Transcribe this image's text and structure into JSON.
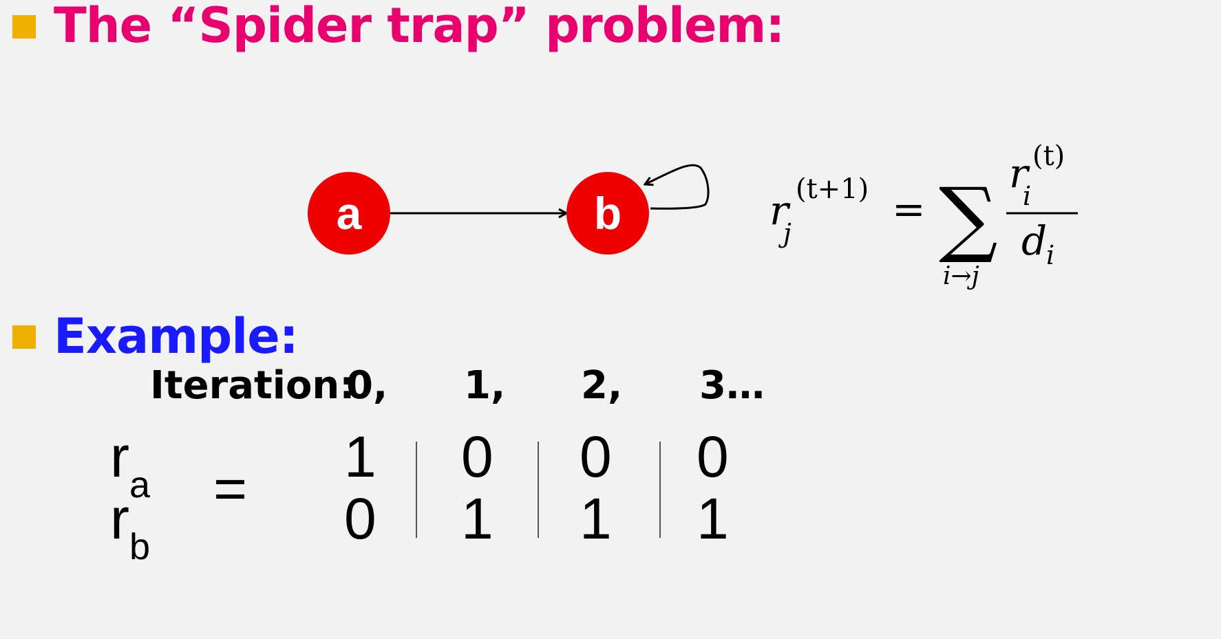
{
  "heading1": "The “Spider trap” problem:",
  "heading2": "Example:",
  "colors": {
    "heading1": "#e8006e",
    "heading2": "#1a1aff",
    "bullet": "#f0b000",
    "node": "#ee0000"
  },
  "graph": {
    "nodes": [
      {
        "id": "a",
        "label": "a"
      },
      {
        "id": "b",
        "label": "b"
      }
    ],
    "edges": [
      {
        "from": "a",
        "to": "b"
      },
      {
        "from": "b",
        "to": "b"
      }
    ]
  },
  "formula": {
    "lhs_base": "r",
    "lhs_sub": "j",
    "lhs_sup": "(t+1)",
    "equals": "=",
    "sum": "∑",
    "sum_index": "i→j",
    "num_base": "r",
    "num_sub": "i",
    "num_sup": "(t)",
    "den_base": "d",
    "den_sub": "i"
  },
  "iteration": {
    "label": "Iteration:",
    "values": [
      "0,",
      "1,",
      "2,",
      "3…"
    ]
  },
  "table": {
    "row_a_base": "r",
    "row_a_sub": "a",
    "row_b_base": "r",
    "row_b_sub": "b",
    "equals": "=",
    "columns": [
      {
        "a": "1",
        "b": "0"
      },
      {
        "a": "0",
        "b": "1"
      },
      {
        "a": "0",
        "b": "1"
      },
      {
        "a": "0",
        "b": "1"
      }
    ]
  }
}
